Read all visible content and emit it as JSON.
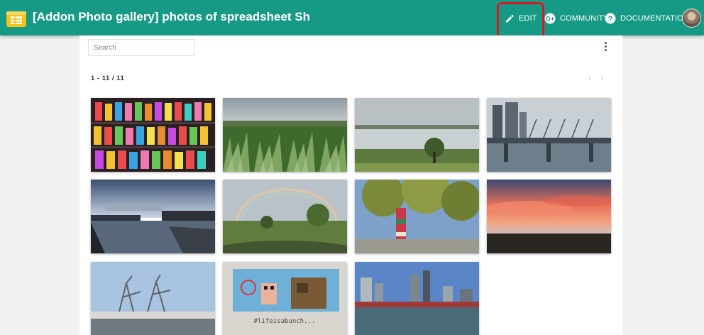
{
  "header": {
    "title": "[Addon Photo gallery] photos of spreadsheet Sh",
    "edit_label": "EDIT",
    "community_label": "COMMUNITY",
    "documentation_label": "DOCUMENTATION",
    "brand_color": "#169a85"
  },
  "search": {
    "placeholder": "Search"
  },
  "gallery": {
    "counter": "1 - 11 / 11",
    "prev_symbol": "‹",
    "next_symbol": "›",
    "photos": [
      "colorful-figurines",
      "green-plants-field",
      "lake-with-trees",
      "bridge-with-city",
      "river-at-dusk",
      "rainbow-over-field",
      "tree-with-knitted-trunk",
      "sunset-sky",
      "sculpture-on-bridge",
      "minecraft-screen-photo",
      "city-river-skyline"
    ]
  }
}
